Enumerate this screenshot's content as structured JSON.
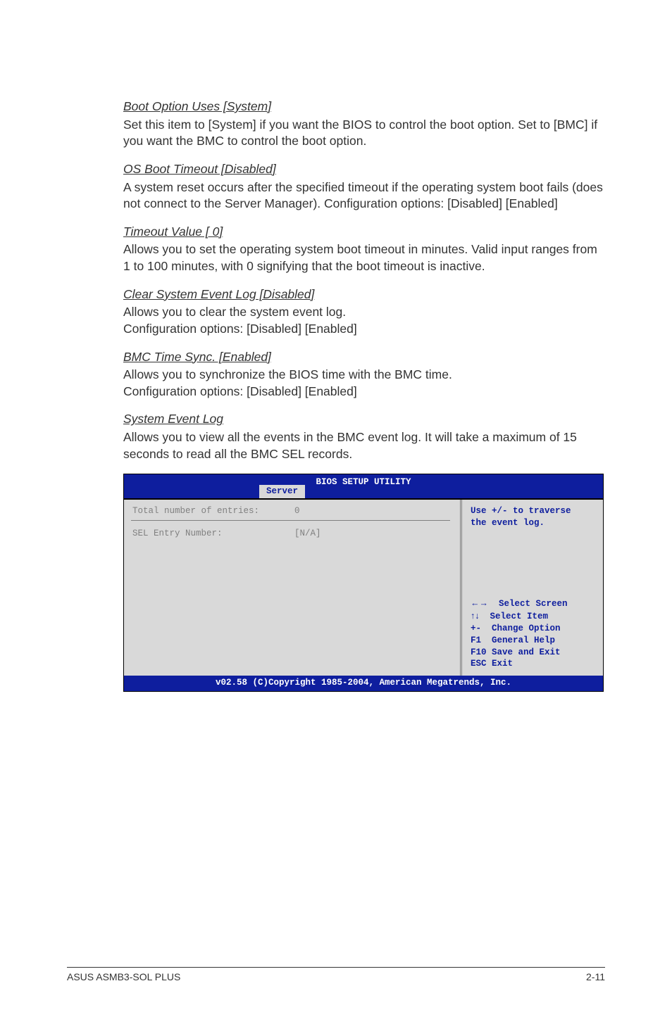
{
  "sections": [
    {
      "heading": "Boot Option Uses [System]",
      "body": "Set this item to [System] if you want the BIOS to control the boot option. Set to [BMC] if you want the BMC to control the boot option."
    },
    {
      "heading": "OS Boot Timeout [Disabled]",
      "body": "A system reset occurs after the specified timeout if the operating system boot fails (does not connect to the Server Manager). Configuration options: [Disabled] [Enabled]"
    },
    {
      "heading": "Timeout Value [  0]",
      "body": "Allows you to set the operating system boot timeout in minutes. Valid input ranges from 1 to 100 minutes, with 0 signifying that the boot timeout is inactive."
    },
    {
      "heading": "Clear System Event Log [Disabled]",
      "body": "Allows you to clear the system event log.\nConfiguration options: [Disabled] [Enabled]"
    },
    {
      "heading": "BMC Time Sync. [Enabled]",
      "body": "Allows you to synchronize the BIOS time with the BMC time.\nConfiguration options: [Disabled] [Enabled]"
    },
    {
      "heading": "System Event Log",
      "body": "Allows you to view all the events in the BMC event log. It will take a maximum of 15 seconds to read all the BMC SEL records."
    }
  ],
  "bios": {
    "title": "BIOS SETUP UTILITY",
    "tab": "Server",
    "total_label": "Total number of entries:",
    "total_value": "0",
    "sel_label": "SEL Entry Number:",
    "sel_value": "[N/A]",
    "hint1": "Use +/- to traverse",
    "hint2": "the event log.",
    "nav": {
      "select_screen": "Select Screen",
      "select_item": "Select Item",
      "change_option": "Change Option",
      "general_help": "General Help",
      "save_exit": "Save and Exit",
      "exit": "Exit",
      "k_arrows_lr": "←→",
      "k_arrows_ud": "↑↓",
      "k_pm": "+-",
      "k_f1": "F1",
      "k_f10": "F10",
      "k_esc": "ESC"
    },
    "footer": "v02.58 (C)Copyright 1985-2004, American Megatrends, Inc."
  },
  "footer": {
    "left": "ASUS ASMB3-SOL PLUS",
    "right": "2-11"
  }
}
